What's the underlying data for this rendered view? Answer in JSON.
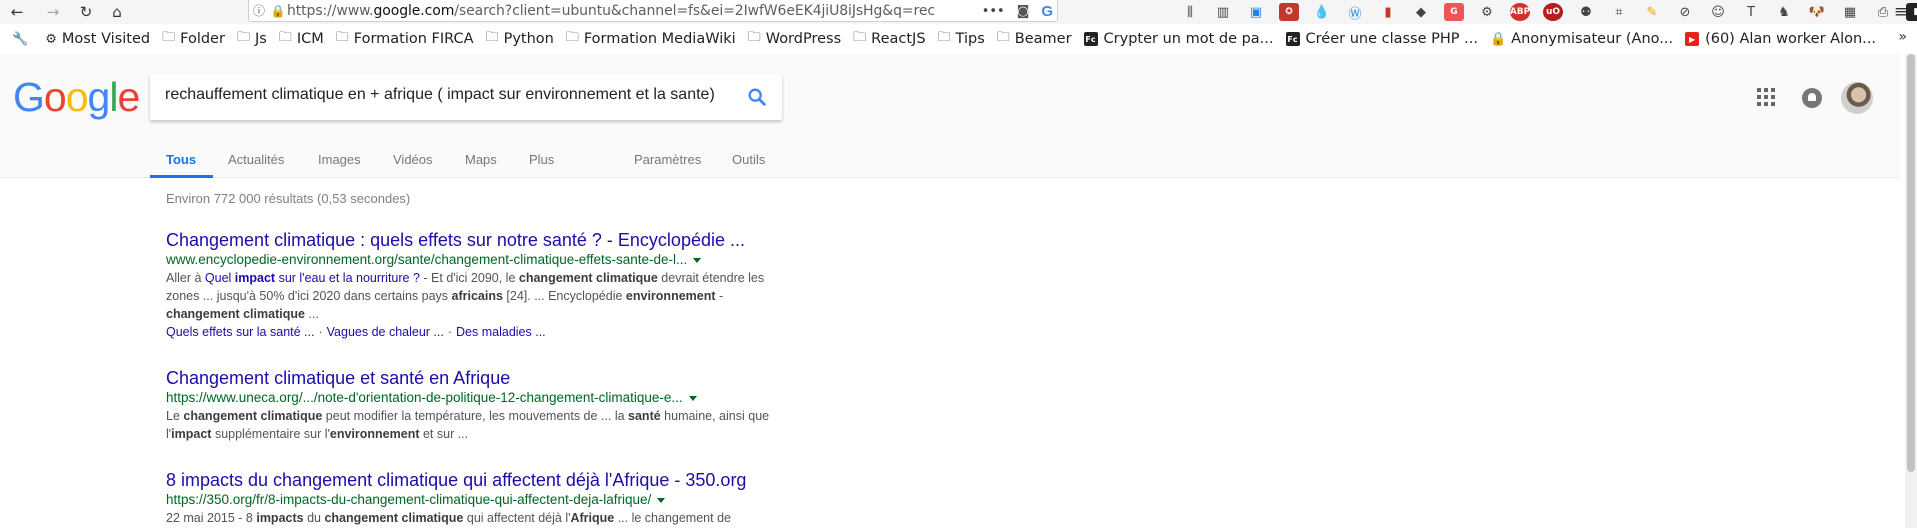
{
  "browser": {
    "url_prefix": "https://www.",
    "url_host": "google.com",
    "url_rest": "/search?client=ubuntu&channel=fs&ei=2IwfW6eEK4jiU8iJsHg&q=rec",
    "url_more": "•••",
    "menu_icon": "≡"
  },
  "bookmarks": {
    "items": [
      {
        "label": "Most Visited",
        "icon": "gear-icon"
      },
      {
        "label": "Folder",
        "icon": "folder-icon"
      },
      {
        "label": "Js",
        "icon": "folder-icon"
      },
      {
        "label": "ICM",
        "icon": "folder-icon"
      },
      {
        "label": "Formation FIRCA",
        "icon": "folder-icon"
      },
      {
        "label": "Python",
        "icon": "folder-icon"
      },
      {
        "label": "Formation MediaWiki",
        "icon": "folder-icon"
      },
      {
        "label": "WordPress",
        "icon": "folder-icon"
      },
      {
        "label": "ReactJS",
        "icon": "folder-icon"
      },
      {
        "label": "Tips",
        "icon": "folder-icon"
      },
      {
        "label": "Beamer",
        "icon": "folder-icon"
      },
      {
        "label": "Crypter un mot de pa...",
        "icon": "fc-icon"
      },
      {
        "label": "Créer une classe PHP ...",
        "icon": "fc-icon"
      },
      {
        "label": "Anonymisateur (Ano...",
        "icon": "lock-icon"
      },
      {
        "label": "(60) Alan worker Alon...",
        "icon": "youtube-icon"
      }
    ],
    "more": "»"
  },
  "google": {
    "search_query": "rechauffement climatique en + afrique ( impact sur environnement et la sante)",
    "tabs": [
      {
        "label": "Tous",
        "active": true
      },
      {
        "label": "Actualités"
      },
      {
        "label": "Images"
      },
      {
        "label": "Vidéos"
      },
      {
        "label": "Maps"
      },
      {
        "label": "Plus"
      },
      {
        "label": "Paramètres"
      },
      {
        "label": "Outils"
      }
    ],
    "stats": "Environ 772 000 résultats (0,53 secondes)"
  },
  "results": [
    {
      "title": "Changement climatique : quels effets sur notre santé ? - Encyclopédie ...",
      "url": "www.encyclopedie-environnement.org/sante/changement-climatique-effets-sante-de-l...",
      "sitelinks": [
        "Quels effets sur la santé ...",
        "Vagues de chaleur ...",
        "Des maladies ..."
      ]
    },
    {
      "title": "Changement climatique et santé en Afrique",
      "url": "https://www.uneca.org/.../note-d'orientation-de-politique-12-changement-climatique-e..."
    },
    {
      "title": "8 impacts du changement climatique qui affectent déjà l'Afrique - 350.org",
      "url": "https://350.org/fr/8-impacts-du-changement-climatique-qui-affectent-deja-lafrique/"
    }
  ],
  "colors": {
    "link": "#1a0dab",
    "url_green": "#006621",
    "tab_active": "#1a73e8",
    "google_blue": "#4285f4",
    "google_red": "#ea4335",
    "google_yellow": "#fbbc05",
    "google_green": "#34a853"
  }
}
